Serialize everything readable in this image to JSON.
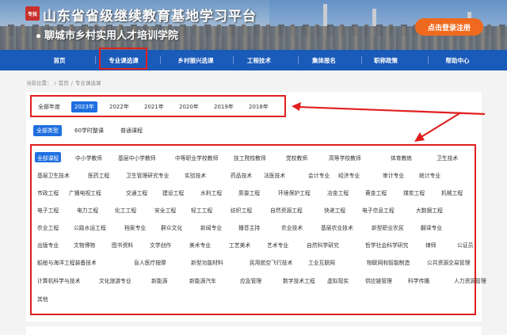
{
  "header": {
    "logo_badge": "专技",
    "title": "山东省省级继续教育基地学习平台",
    "subtitle": "聊城市乡村实用人才培训学院",
    "login_label": "点击登录注册"
  },
  "nav": [
    "首页",
    "专业课选课",
    "乡村振兴选课",
    "工程技术",
    "集体报名",
    "职称政策",
    "帮助中心"
  ],
  "breadcrumb": {
    "prefix": "当前位置：",
    "home": "首页",
    "current": "专业课选课",
    "sep": "/"
  },
  "years": [
    "全部年度",
    "2023年",
    "2022年",
    "2021年",
    "2020年",
    "2019年",
    "2018年"
  ],
  "course_types": [
    "全部类型",
    "60学时整课",
    "普通课程"
  ],
  "categories": [
    [
      "全部课程",
      "中小学教师",
      "基层中小学教师",
      "中等职业学校教师",
      "技工院校教师",
      "党校教师",
      "高等学校教师",
      "体育教练",
      "卫生技术"
    ],
    [
      "基层卫生技术",
      "医药工程",
      "卫生管理研究专业",
      "实验技术",
      "药品技术",
      "法医技术",
      "会计专业",
      "经济专业",
      "审计专业",
      "统计专业"
    ],
    [
      "市政工程",
      "广播电视工程",
      "交通工程",
      "建设工程",
      "水利工程",
      "质量工程",
      "环境保护工程",
      "冶金工程",
      "黄金工程",
      "煤炭工程",
      "机械工程"
    ],
    [
      "电子工程",
      "电力工程",
      "化工工程",
      "安全工程",
      "轻工工程",
      "纺织工程",
      "自然资源工程",
      "快递工程",
      "电子信息工程",
      "大数据工程"
    ],
    [
      "农业工程",
      "公路水运工程",
      "档案专业",
      "群众文化",
      "新闻专业",
      "播音主持",
      "农业技术",
      "基层农业技术",
      "新型职业农民",
      "翻译专业"
    ],
    [
      "出版专业",
      "文物博物",
      "图书资料",
      "文学创作",
      "美术专业",
      "工艺美术",
      "艺术专业",
      "自然科学研究",
      "哲学社会科学研究",
      "律师",
      "公证员"
    ],
    [
      "船舶与海洋工程装备技术",
      "盲人医疗按摩",
      "新型功能材料",
      "民用航空飞行技术",
      "工业互联网",
      "物联网和智能制造",
      "公共资源交易管理"
    ],
    [
      "计算机科学与技术",
      "文化旅游专业",
      "新能源",
      "新能源汽车",
      "应急管理",
      "数字技术工程",
      "虚拟现实",
      "供应链管理",
      "科学传播",
      "人力资源管理"
    ],
    [
      "其他"
    ]
  ],
  "colors": {
    "nav_bg": "#1a5ab8",
    "active_bg": "#1f6fe0",
    "login_bg": "#ef6a1f",
    "highlight": "#e02020"
  }
}
